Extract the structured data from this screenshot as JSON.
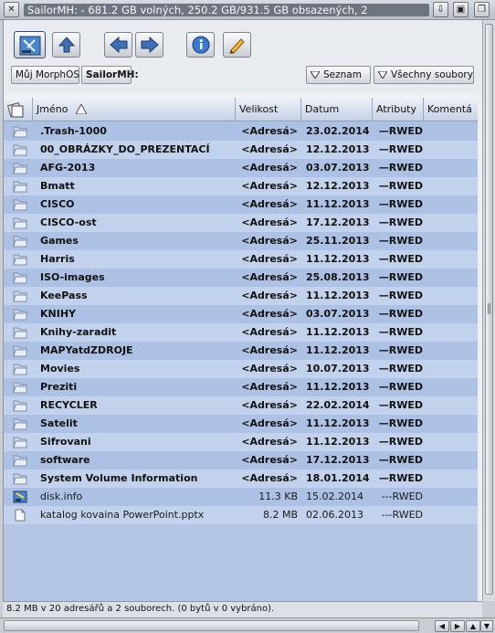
{
  "window": {
    "title": "SailorMH: - 681.2 GB volných, 250.2 GB/931.5 GB obsazených, 2"
  },
  "toolbar": {
    "path_buttons": [
      "Můj MorphOS",
      "SailorMH:"
    ],
    "view_buttons": [
      "Seznam",
      "Všechny soubory"
    ]
  },
  "list": {
    "columns": [
      "Jméno",
      "Velikost",
      "Datum",
      "Atributy",
      "Komentá"
    ],
    "sort_column": "Jméno",
    "rows": [
      {
        "type": "dir",
        "name": ".Trash-1000",
        "size": "<Adresá>",
        "date": "23.02.2014",
        "attr": "—RWED"
      },
      {
        "type": "dir",
        "name": "00_OBRÁZKY_DO_PREZENTACÍ",
        "size": "<Adresá>",
        "date": "12.12.2013",
        "attr": "—RWED"
      },
      {
        "type": "dir",
        "name": "AFG-2013",
        "size": "<Adresá>",
        "date": "03.07.2013",
        "attr": "—RWED"
      },
      {
        "type": "dir",
        "name": "Bmatt",
        "size": "<Adresá>",
        "date": "12.12.2013",
        "attr": "—RWED"
      },
      {
        "type": "dir",
        "name": "CISCO",
        "size": "<Adresá>",
        "date": "11.12.2013",
        "attr": "—RWED"
      },
      {
        "type": "dir",
        "name": "CISCO-ost",
        "size": "<Adresá>",
        "date": "17.12.2013",
        "attr": "—RWED"
      },
      {
        "type": "dir",
        "name": "Games",
        "size": "<Adresá>",
        "date": "25.11.2013",
        "attr": "—RWED"
      },
      {
        "type": "dir",
        "name": "Harris",
        "size": "<Adresá>",
        "date": "11.12.2013",
        "attr": "—RWED"
      },
      {
        "type": "dir",
        "name": "ISO-images",
        "size": "<Adresá>",
        "date": "25.08.2013",
        "attr": "—RWED"
      },
      {
        "type": "dir",
        "name": "KeePass",
        "size": "<Adresá>",
        "date": "11.12.2013",
        "attr": "—RWED"
      },
      {
        "type": "dir",
        "name": "KNIHY",
        "size": "<Adresá>",
        "date": "03.07.2013",
        "attr": "—RWED"
      },
      {
        "type": "dir",
        "name": "Knihy-zaradit",
        "size": "<Adresá>",
        "date": "11.12.2013",
        "attr": "—RWED"
      },
      {
        "type": "dir",
        "name": "MAPYatdZDROJE",
        "size": "<Adresá>",
        "date": "11.12.2013",
        "attr": "—RWED"
      },
      {
        "type": "dir",
        "name": "Movies",
        "size": "<Adresá>",
        "date": "10.07.2013",
        "attr": "—RWED"
      },
      {
        "type": "dir",
        "name": "Preziti",
        "size": "<Adresá>",
        "date": "11.12.2013",
        "attr": "—RWED"
      },
      {
        "type": "dir",
        "name": "RECYCLER",
        "size": "<Adresá>",
        "date": "22.02.2014",
        "attr": "—RWED"
      },
      {
        "type": "dir",
        "name": "Satelit",
        "size": "<Adresá>",
        "date": "11.12.2013",
        "attr": "—RWED"
      },
      {
        "type": "dir",
        "name": "Sifrovani",
        "size": "<Adresá>",
        "date": "11.12.2013",
        "attr": "—RWED"
      },
      {
        "type": "dir",
        "name": "software",
        "size": "<Adresá>",
        "date": "17.12.2013",
        "attr": "—RWED"
      },
      {
        "type": "dir",
        "name": "System Volume Information",
        "size": "<Adresá>",
        "date": "18.01.2014",
        "attr": "—RWED"
      },
      {
        "type": "file",
        "icon": "disk-info-icon",
        "name": "disk.info",
        "size": "11.3 KB",
        "date": "15.02.2014",
        "attr": "---RWED"
      },
      {
        "type": "file",
        "icon": "document-icon",
        "name": "katalog kovaina PowerPoint.pptx",
        "size": "8.2 MB",
        "date": "02.06.2013",
        "attr": "---RWED"
      }
    ]
  },
  "status": {
    "text": "8.2 MB v 20 adresářů a 2 souborech. (0 bytů v 0 vybráno)."
  },
  "colors": {
    "row_odd": "#adc1e5",
    "row_even": "#c2d1ec",
    "title_bar": "#6e7480"
  }
}
